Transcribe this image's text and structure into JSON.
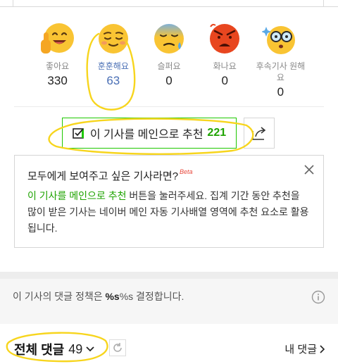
{
  "reactions": [
    {
      "label": "좋아요",
      "count": "330",
      "selected": false,
      "icon": "like-face-icon"
    },
    {
      "label": "훈훈해요",
      "count": "63",
      "selected": true,
      "icon": "warm-face-icon"
    },
    {
      "label": "슬퍼요",
      "count": "0",
      "selected": false,
      "icon": "sad-face-icon"
    },
    {
      "label": "화나요",
      "count": "0",
      "selected": false,
      "icon": "angry-face-icon"
    },
    {
      "label": "후속기사 원해요",
      "count": "0",
      "selected": false,
      "icon": "want-followup-face-icon"
    }
  ],
  "recommend": {
    "label": "이 기사를 메인으로 추천",
    "count": "221"
  },
  "tooltip": {
    "title": "모두에게 보여주고 싶은 기사라면?",
    "beta": "Beta",
    "link_text": "이 기사를 메인으로 추천",
    "body_text": " 버튼을 눌러주세요. 집계 기간 동안 추천을 많이 받은 기사는 네이버 메인 자동 기사배열 영역에 추천 요소로 활용됩니다."
  },
  "policy": {
    "prefix": "이 기사의 댓글 정책은 ",
    "bold": "%s",
    "suffix": "%s 결정합니다."
  },
  "comments": {
    "total_label": "전체 댓글",
    "total_count": "49",
    "my_comments": "내 댓글"
  },
  "colors": {
    "accent_green": "#1ea300",
    "selected_blue": "#4a6fb5",
    "annotation_yellow": "#f7d51d"
  }
}
